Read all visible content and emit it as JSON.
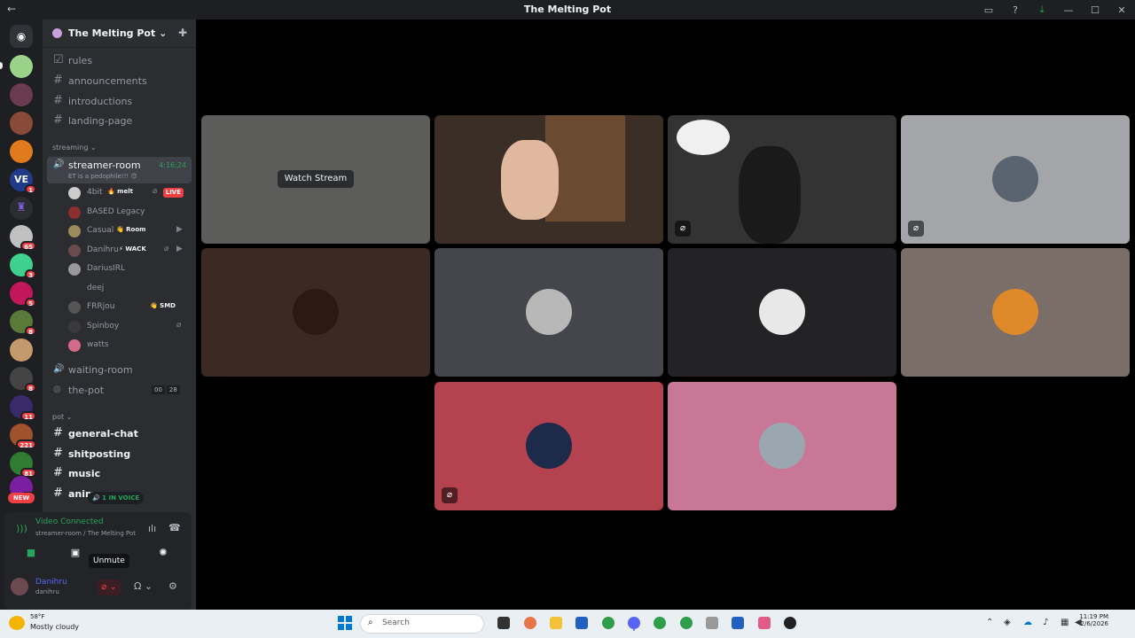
{
  "window": {
    "title": "The Melting Pot",
    "back_glyph": "←",
    "icons": [
      "inbox-icon",
      "help-icon",
      "download-icon",
      "minimize-icon",
      "maximize-icon",
      "close-icon"
    ],
    "icon_glyphs": [
      "▭",
      "?",
      "⤓",
      "—",
      "☐",
      "✕"
    ]
  },
  "server": {
    "name": "The Melting Pot",
    "chevron": "⌄"
  },
  "server_badges": [
    "65",
    "1",
    "3",
    "5",
    "8",
    "8",
    "11",
    "221",
    "81",
    "81"
  ],
  "new_label": "NEW",
  "channels": {
    "top": [
      "rules",
      "announcements",
      "introductions",
      "landing-page"
    ],
    "streaming_category": "streaming ⌄",
    "active_voice": {
      "name": "streamer-room",
      "time": "4:16:24",
      "status": "ET is a pedophile!!! 😊"
    },
    "voice_users": [
      {
        "name": "4bit",
        "tag": "🔥 melt",
        "live": "LIVE"
      },
      {
        "name": "BASED Legacy",
        "tag": ""
      },
      {
        "name": "Casual",
        "tag": "👋 Room"
      },
      {
        "name": "Danihru",
        "tag": "⚡ WACK"
      },
      {
        "name": "DariusIRL",
        "tag": ""
      },
      {
        "name": "deej",
        "tag": ""
      },
      {
        "name": "FRRjou",
        "tag": "👋 SMD"
      },
      {
        "name": "Spinboy",
        "tag": ""
      },
      {
        "name": "watts",
        "tag": ""
      }
    ],
    "waiting_room": "waiting-room",
    "the_pot": "the-pot",
    "the_pot_counts": [
      "00",
      "28"
    ],
    "pot_category": "pot ⌄",
    "pot": [
      "general-chat",
      "shitposting",
      "music",
      "anim"
    ],
    "in_voice": "1 IN VOICE"
  },
  "voice_panel": {
    "status": "Video Connected",
    "sub": "streamer-room / The Melting Pot",
    "tooltip": "Unmute"
  },
  "user": {
    "display": "Danihru",
    "tag": "danihru"
  },
  "stage": {
    "watch_label": "Watch Stream"
  },
  "taskbar": {
    "temp": "58°F",
    "condition": "Mostly cloudy",
    "search_placeholder": "Search",
    "time": "11:19 PM",
    "date": "2/6/2026"
  },
  "colors": {
    "accent": "#5865f2",
    "green": "#23a55a",
    "red": "#f23f43",
    "tile_red": "#b5424f",
    "tile_pink": "#c87896"
  }
}
